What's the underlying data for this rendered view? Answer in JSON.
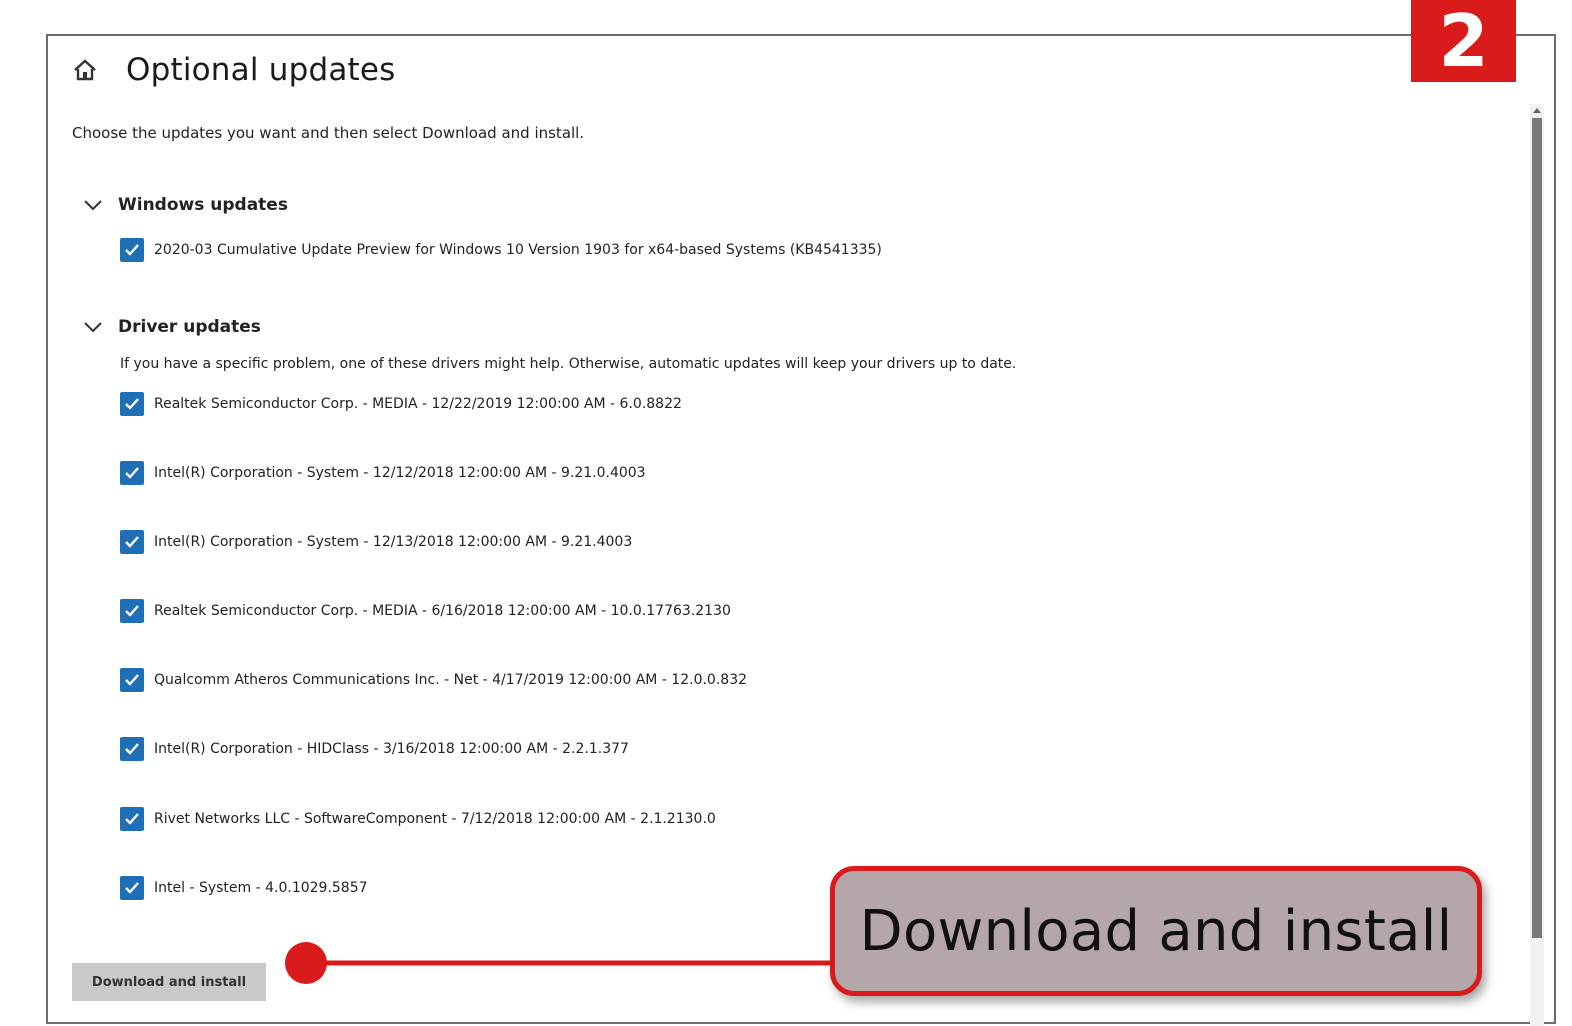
{
  "page": {
    "title": "Optional updates",
    "intro": "Choose the updates you want and then select Download and install."
  },
  "windows_updates": {
    "heading": "Windows updates",
    "items": [
      {
        "label": "2020-03 Cumulative Update Preview for Windows 10 Version 1903 for x64-based Systems (KB4541335)",
        "checked": true
      }
    ]
  },
  "driver_updates": {
    "heading": "Driver updates",
    "note": "If you have a specific problem, one of these drivers might help. Otherwise, automatic updates will keep your drivers up to date.",
    "items": [
      {
        "label": "Realtek Semiconductor Corp. - MEDIA - 12/22/2019 12:00:00 AM - 6.0.8822",
        "checked": true
      },
      {
        "label": "Intel(R) Corporation - System - 12/12/2018 12:00:00 AM - 9.21.0.4003",
        "checked": true
      },
      {
        "label": "Intel(R) Corporation - System - 12/13/2018 12:00:00 AM - 9.21.4003",
        "checked": true
      },
      {
        "label": "Realtek Semiconductor Corp. - MEDIA - 6/16/2018 12:00:00 AM - 10.0.17763.2130",
        "checked": true
      },
      {
        "label": "Qualcomm Atheros Communications Inc. - Net - 4/17/2019 12:00:00 AM - 12.0.0.832",
        "checked": true
      },
      {
        "label": "Intel(R) Corporation - HIDClass - 3/16/2018 12:00:00 AM - 2.2.1.377",
        "checked": true
      },
      {
        "label": "Rivet Networks LLC - SoftwareComponent - 7/12/2018 12:00:00 AM - 2.1.2130.0",
        "checked": true
      },
      {
        "label": "Intel - System - 4.0.1029.5857",
        "checked": true
      }
    ]
  },
  "download_button": {
    "label": "Download and install"
  },
  "annotation": {
    "step_number": "2",
    "callout_text": "Download and install",
    "accent_color": "#d91b1b"
  },
  "colors": {
    "checkbox": "#1f6fb7",
    "button_bg": "#c9c9c9",
    "callout_bg": "#b4a6a9"
  }
}
